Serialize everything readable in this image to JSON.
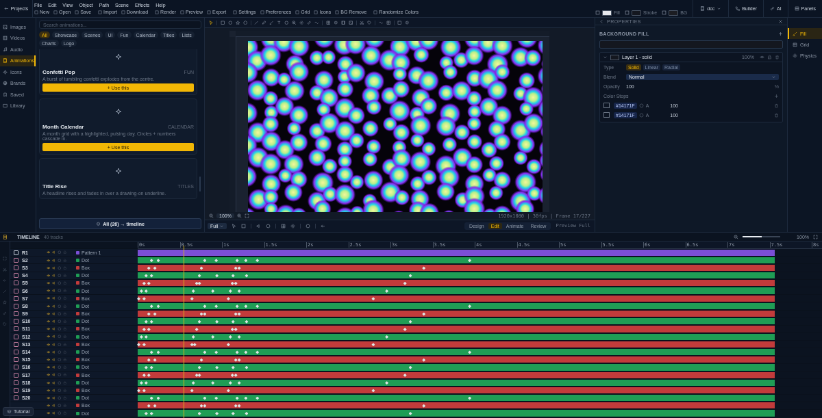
{
  "menu_bar": {
    "back": "Projects",
    "menus": [
      "File",
      "Edit",
      "View",
      "Object",
      "Path",
      "Scene",
      "Effects",
      "Help"
    ]
  },
  "toolbar": {
    "groups": [
      [
        "New",
        "Open",
        "Save"
      ],
      [
        "Import",
        "Download"
      ],
      [
        "Render",
        "Preview",
        "Export"
      ],
      [
        "Settings",
        "Preferences",
        "Grid",
        "Icons",
        "BG Remove"
      ],
      [
        "Randomize Colors"
      ]
    ]
  },
  "style_swatches": [
    {
      "label": "Fill",
      "color": "#e6e8ec"
    },
    {
      "label": "Stroke",
      "color": "#14171f"
    },
    {
      "label": "BG",
      "color": "#1c1d22"
    }
  ],
  "workspace": "dcc",
  "top_actions": [
    "Builder",
    "AI",
    "Panels"
  ],
  "sidebar": [
    {
      "label": "Images",
      "selected": false
    },
    {
      "label": "Videos",
      "selected": false
    },
    {
      "label": "Audio",
      "selected": false
    },
    {
      "label": "Animations",
      "selected": true
    },
    {
      "label": "Icons",
      "selected": false
    },
    {
      "label": "Brands",
      "selected": false
    },
    {
      "label": "Saved",
      "selected": false
    },
    {
      "label": "Library",
      "selected": false
    }
  ],
  "library": {
    "search_placeholder": "Search animations...",
    "filters": [
      {
        "label": "All",
        "selected": true
      },
      {
        "label": "Showcase",
        "selected": false
      },
      {
        "label": "Scenes",
        "selected": false
      },
      {
        "label": "UI",
        "selected": false
      },
      {
        "label": "Fun",
        "selected": false
      },
      {
        "label": "Calendar",
        "selected": false
      },
      {
        "label": "Titles",
        "selected": false
      },
      {
        "label": "Lists",
        "selected": false
      },
      {
        "label": "Charts",
        "selected": false
      },
      {
        "label": "Logo",
        "selected": false
      }
    ],
    "cards": [
      {
        "title": "Confetti Pop",
        "tag": "FUN",
        "description": "A burst of tumbling confetti explodes from the centre.",
        "button": "+ Use this"
      },
      {
        "title": "Month Calendar",
        "tag": "CALENDAR",
        "description": "A month grid with a highlighted, pulsing day. Circles + numbers cascade in.",
        "button": "+ Use this"
      },
      {
        "title": "Title Rise",
        "tag": "TITLES",
        "description": "A headline rises and fades in over a drawing-on underline."
      }
    ],
    "add_all": "All (26) → timeline"
  },
  "canvas": {
    "zoom": "100%",
    "info": "1920x1080 | 30fps | Frame 17/227",
    "fit": "Full",
    "modes": [
      {
        "label": "Design",
        "selected": false
      },
      {
        "label": "Edit",
        "selected": true
      },
      {
        "label": "Animate",
        "selected": false
      },
      {
        "label": "Review",
        "selected": false
      }
    ],
    "preview": "Preview Full"
  },
  "properties": {
    "title": "PROPERTIES",
    "section": "BACKGROUND FILL",
    "layer": {
      "name": "Layer 1 - solid",
      "opacity": "100%",
      "type_label": "Type",
      "types": [
        {
          "label": "Solid",
          "selected": true
        },
        {
          "label": "Linear",
          "selected": false
        },
        {
          "label": "Radial",
          "selected": false
        }
      ],
      "blend_label": "Blend",
      "blend": "Normal",
      "opacity_label": "Opacity",
      "opacity_value": "100",
      "opacity_unit": "%",
      "stops_label": "Color Stops",
      "stops": [
        {
          "hex": "#14171F",
          "alpha_label": "A",
          "alpha": "100"
        },
        {
          "hex": "#14171F",
          "alpha_label": "A",
          "alpha": "100"
        }
      ]
    }
  },
  "panel_tabs": [
    {
      "label": "Fill",
      "selected": true
    },
    {
      "label": "Grid",
      "selected": false
    },
    {
      "label": "Physics",
      "selected": false
    }
  ],
  "timeline": {
    "title": "TIMELINE",
    "count": "40 tracks",
    "zoom": "100%",
    "zoom_slider": {
      "level": 0.5
    },
    "ticks": [
      "0s",
      "0.5s",
      "1s",
      "1.5s",
      "2s",
      "2.5s",
      "3s",
      "3.5s",
      "4s",
      "4.5s",
      "5s",
      "5.5s",
      "6s",
      "6.5s",
      "7s",
      "7.5s",
      "8s"
    ],
    "playhead": {
      "level": 0.068
    },
    "tracks": [
      {
        "name": "R1",
        "label": "Pattern 1",
        "color": "#7b4fd6",
        "checked": false
      },
      {
        "name": "S2",
        "label": "Dot",
        "color": "#1f9d55",
        "checked": false,
        "keyframes": [
          {
            "level": 0.019
          },
          {
            "level": 0.029
          },
          {
            "level": 0.098
          },
          {
            "level": 0.115
          },
          {
            "level": 0.146
          },
          {
            "level": 0.159
          },
          {
            "level": 0.176
          },
          {
            "level": 0.491
          }
        ]
      },
      {
        "name": "S3",
        "label": "Box",
        "color": "#c23b3b",
        "checked": false,
        "keyframes": [
          {
            "level": 0.015
          },
          {
            "level": 0.024
          },
          {
            "level": 0.093
          },
          {
            "level": 0.144
          },
          {
            "level": 0.149
          },
          {
            "level": 0.423
          }
        ]
      },
      {
        "name": "S4",
        "label": "Dot",
        "color": "#1f9d55",
        "checked": false,
        "keyframes": [
          {
            "level": 0.011
          },
          {
            "level": 0.019
          },
          {
            "level": 0.09
          },
          {
            "level": 0.116
          },
          {
            "level": 0.14
          },
          {
            "level": 0.16
          },
          {
            "level": 0.403
          }
        ]
      },
      {
        "name": "S5",
        "label": "Box",
        "color": "#c23b3b",
        "checked": false,
        "keyframes": [
          {
            "level": 0.008
          },
          {
            "level": 0.015
          },
          {
            "level": 0.086
          },
          {
            "level": 0.09
          },
          {
            "level": 0.139
          },
          {
            "level": 0.144
          },
          {
            "level": 0.395
          }
        ]
      },
      {
        "name": "S6",
        "label": "Dot",
        "color": "#1f9d55",
        "checked": false,
        "keyframes": [
          {
            "level": 0.004
          },
          {
            "level": 0.011
          },
          {
            "level": 0.081
          },
          {
            "level": 0.11
          },
          {
            "level": 0.136
          },
          {
            "level": 0.149
          },
          {
            "level": 0.368
          }
        ]
      },
      {
        "name": "S7",
        "label": "Box",
        "color": "#c23b3b",
        "checked": false,
        "keyframes": [
          {
            "level": 0
          },
          {
            "level": 0.008
          },
          {
            "level": 0.079
          },
          {
            "level": 0.133
          },
          {
            "level": 0.348
          }
        ]
      },
      {
        "name": "S8",
        "label": "Dot",
        "color": "#1f9d55",
        "checked": false,
        "keyframes": [
          {
            "level": 0.019
          },
          {
            "level": 0.029
          },
          {
            "level": 0.098
          },
          {
            "level": 0.115
          },
          {
            "level": 0.146
          },
          {
            "level": 0.159
          },
          {
            "level": 0.176
          },
          {
            "level": 0.491
          }
        ]
      },
      {
        "name": "S9",
        "label": "Box",
        "color": "#c23b3b",
        "checked": false,
        "keyframes": [
          {
            "level": 0.015
          },
          {
            "level": 0.024
          },
          {
            "level": 0.093
          },
          {
            "level": 0.098
          },
          {
            "level": 0.144
          },
          {
            "level": 0.149
          },
          {
            "level": 0.423
          }
        ]
      },
      {
        "name": "S10",
        "label": "Dot",
        "color": "#1f9d55",
        "checked": false,
        "keyframes": [
          {
            "level": 0.011
          },
          {
            "level": 0.019
          },
          {
            "level": 0.09
          },
          {
            "level": 0.116
          },
          {
            "level": 0.14
          },
          {
            "level": 0.16
          },
          {
            "level": 0.403
          }
        ]
      },
      {
        "name": "S11",
        "label": "Box",
        "color": "#c23b3b",
        "checked": false,
        "keyframes": [
          {
            "level": 0.008
          },
          {
            "level": 0.015
          },
          {
            "level": 0.086
          },
          {
            "level": 0.139
          },
          {
            "level": 0.144
          },
          {
            "level": 0.395
          }
        ]
      },
      {
        "name": "S12",
        "label": "Dot",
        "color": "#1f9d55",
        "checked": false,
        "keyframes": [
          {
            "level": 0.004
          },
          {
            "level": 0.011
          },
          {
            "level": 0.081
          },
          {
            "level": 0.11
          },
          {
            "level": 0.136
          },
          {
            "level": 0.149
          },
          {
            "level": 0.368
          }
        ]
      },
      {
        "name": "S13",
        "label": "Box",
        "color": "#c23b3b",
        "checked": false,
        "keyframes": [
          {
            "level": 0
          },
          {
            "level": 0.008
          },
          {
            "level": 0.079
          },
          {
            "level": 0.083
          },
          {
            "level": 0.133
          },
          {
            "level": 0.348
          }
        ]
      },
      {
        "name": "S14",
        "label": "Dot",
        "color": "#1f9d55",
        "checked": false,
        "keyframes": [
          {
            "level": 0.019
          },
          {
            "level": 0.029
          },
          {
            "level": 0.098
          },
          {
            "level": 0.115
          },
          {
            "level": 0.146
          },
          {
            "level": 0.159
          },
          {
            "level": 0.176
          },
          {
            "level": 0.491
          }
        ]
      },
      {
        "name": "S15",
        "label": "Box",
        "color": "#c23b3b",
        "checked": false,
        "keyframes": [
          {
            "level": 0.015
          },
          {
            "level": 0.024
          },
          {
            "level": 0.093
          },
          {
            "level": 0.144
          },
          {
            "level": 0.149
          },
          {
            "level": 0.423
          }
        ]
      },
      {
        "name": "S16",
        "label": "Dot",
        "color": "#1f9d55",
        "checked": false,
        "keyframes": [
          {
            "level": 0.011
          },
          {
            "level": 0.019
          },
          {
            "level": 0.09
          },
          {
            "level": 0.116
          },
          {
            "level": 0.14
          },
          {
            "level": 0.16
          },
          {
            "level": 0.403
          }
        ]
      },
      {
        "name": "S17",
        "label": "Box",
        "color": "#c23b3b",
        "checked": false,
        "keyframes": [
          {
            "level": 0.008
          },
          {
            "level": 0.015
          },
          {
            "level": 0.086
          },
          {
            "level": 0.09
          },
          {
            "level": 0.139
          },
          {
            "level": 0.144
          },
          {
            "level": 0.395
          }
        ]
      },
      {
        "name": "S18",
        "label": "Dot",
        "color": "#1f9d55",
        "checked": false,
        "keyframes": [
          {
            "level": 0.004
          },
          {
            "level": 0.011
          },
          {
            "level": 0.081
          },
          {
            "level": 0.11
          },
          {
            "level": 0.136
          },
          {
            "level": 0.149
          },
          {
            "level": 0.368
          }
        ]
      },
      {
        "name": "S19",
        "label": "Box",
        "color": "#c23b3b",
        "checked": false,
        "keyframes": [
          {
            "level": 0
          },
          {
            "level": 0.008
          },
          {
            "level": 0.079
          },
          {
            "level": 0.133
          },
          {
            "level": 0.348
          }
        ]
      },
      {
        "name": "S20",
        "label": "Dot",
        "color": "#1f9d55",
        "checked": false,
        "keyframes": [
          {
            "level": 0.019
          },
          {
            "level": 0.029
          },
          {
            "level": 0.098
          },
          {
            "level": 0.115
          },
          {
            "level": 0.146
          },
          {
            "level": 0.159
          },
          {
            "level": 0.176
          },
          {
            "level": 0.491
          }
        ]
      },
      {
        "label": "Box",
        "color": "#c23b3b",
        "keyframes": [
          {
            "level": 0.015
          },
          {
            "level": 0.024
          },
          {
            "level": 0.093
          },
          {
            "level": 0.098
          },
          {
            "level": 0.144
          },
          {
            "level": 0.149
          },
          {
            "level": 0.423
          }
        ]
      },
      {
        "label": "Dot",
        "color": "#1f9d55",
        "keyframes": [
          {
            "level": 0.011
          },
          {
            "level": 0.019
          },
          {
            "level": 0.09
          },
          {
            "level": 0.116
          },
          {
            "level": 0.14
          },
          {
            "level": 0.16
          },
          {
            "level": 0.403
          }
        ]
      }
    ],
    "tutorial": "Tutorial"
  }
}
